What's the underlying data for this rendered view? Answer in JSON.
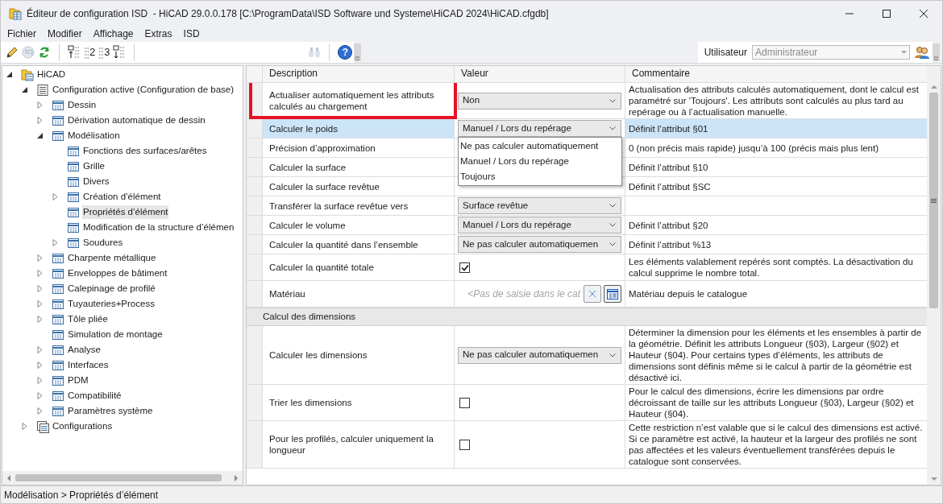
{
  "window": {
    "title": "Éditeur de configuration ISD  - HiCAD 29.0.0.178 [C:\\ProgramData\\ISD Software und Systeme\\HiCAD 2024\\HiCAD.cfgdb]"
  },
  "menu": [
    "Fichier",
    "Modifier",
    "Affichage",
    "Extras",
    "ISD"
  ],
  "toolbar": [
    {
      "kind": "pencil",
      "disabled": false
    },
    {
      "kind": "undo",
      "disabled": true
    },
    {
      "kind": "refresh",
      "disabled": false
    },
    {
      "kind": "separator"
    },
    {
      "kind": "level-up",
      "disabled": false
    },
    {
      "kind": "level",
      "label": "2",
      "disabled": false
    },
    {
      "kind": "level",
      "label": "3",
      "disabled": false
    },
    {
      "kind": "level-down",
      "disabled": false
    },
    {
      "kind": "separator"
    },
    {
      "kind": "binoculars",
      "disabled": true
    },
    {
      "kind": "separator"
    },
    {
      "kind": "help",
      "label": "?",
      "disabled": false
    }
  ],
  "user": {
    "label": "Utilisateur",
    "value": "Administrateur",
    "disabled": true
  },
  "tree": [
    {
      "label": "HiCAD",
      "kind": "root",
      "expanded": true,
      "selected": false,
      "children": [
        {
          "label": "Configuration active (Configuration de base)",
          "kind": "page",
          "expanded": true,
          "selected": false,
          "children": [
            {
              "label": "Dessin",
              "kind": "table",
              "expanded": false,
              "selected": false
            },
            {
              "label": "Dérivation automatique de dessin",
              "kind": "table",
              "expanded": false,
              "selected": false
            },
            {
              "label": "Modélisation",
              "kind": "table",
              "expanded": true,
              "selected": false,
              "children": [
                {
                  "label": "Fonctions des surfaces/arêtes",
                  "kind": "table",
                  "selected": false
                },
                {
                  "label": "Grille",
                  "kind": "table",
                  "selected": false
                },
                {
                  "label": "Divers",
                  "kind": "table",
                  "selected": false
                },
                {
                  "label": "Création d’élément",
                  "kind": "table",
                  "expanded": false,
                  "selected": false
                },
                {
                  "label": "Propriétés d’élément",
                  "kind": "table",
                  "selected": true
                },
                {
                  "label": "Modification de la structure d’élémen",
                  "kind": "table",
                  "selected": false
                },
                {
                  "label": "Soudures",
                  "kind": "table",
                  "expanded": false,
                  "selected": false
                }
              ]
            },
            {
              "label": "Charpente métallique",
              "kind": "table",
              "expanded": false,
              "selected": false
            },
            {
              "label": "Enveloppes de bâtiment",
              "kind": "table",
              "expanded": false,
              "selected": false
            },
            {
              "label": "Calepinage de profilé",
              "kind": "table",
              "expanded": false,
              "selected": false
            },
            {
              "label": "Tuyauteries+Process",
              "kind": "table",
              "expanded": false,
              "selected": false
            },
            {
              "label": "Tôle pliée",
              "kind": "table",
              "expanded": false,
              "selected": false
            },
            {
              "label": "Simulation de montage",
              "kind": "table",
              "selected": false
            },
            {
              "label": "Analyse",
              "kind": "table",
              "expanded": false,
              "selected": false
            },
            {
              "label": "Interfaces",
              "kind": "table",
              "expanded": false,
              "selected": false
            },
            {
              "label": "PDM",
              "kind": "table",
              "expanded": false,
              "selected": false
            },
            {
              "label": "Compatibilité",
              "kind": "table",
              "expanded": false,
              "selected": false
            },
            {
              "label": "Paramètres système",
              "kind": "table",
              "expanded": false,
              "selected": false
            }
          ]
        },
        {
          "label": "Configurations",
          "kind": "list",
          "expanded": false,
          "selected": false
        }
      ]
    }
  ],
  "grid": {
    "columns": [
      "Description",
      "Valeur",
      "Commentaire"
    ],
    "rows": [
      {
        "kind": "dropdown",
        "description": "Actualiser automatiquement les attributs calculés au chargement",
        "value": "Non",
        "comment": "Actualisation des attributs calculés automatiquement, dont le calcul est paramétré sur 'Toujours'. Les attributs sont calculés au plus tard au repérage ou à l’actualisation manuelle.",
        "selected": false,
        "highlighted": true
      },
      {
        "kind": "dropdown",
        "description": "Calculer le poids",
        "value": "Manuel / Lors du repérage",
        "comment": "Définit l’attribut §01",
        "selected": true,
        "highlighted": false,
        "options": [
          "Ne pas calculer automatiquement",
          "Manuel / Lors du repérage",
          "Toujours"
        ]
      },
      {
        "kind": "text",
        "description": "Précision d’approximation",
        "comment": "0 (non précis mais rapide) jusqu’à 100 (précis mais plus lent)",
        "selected": false,
        "highlighted": false
      },
      {
        "kind": "text",
        "description": "Calculer la surface",
        "comment": "Définit l’attribut §10",
        "selected": false,
        "highlighted": false
      },
      {
        "kind": "text",
        "description": "Calculer la surface revêtue",
        "comment": "Définit l’attribut §SC",
        "selected": false,
        "highlighted": false
      },
      {
        "kind": "dropdown",
        "description": "Transférer la surface revêtue vers",
        "value": "Surface revêtue",
        "selected": false,
        "highlighted": false
      },
      {
        "kind": "dropdown",
        "description": "Calculer le volume",
        "value": "Manuel / Lors du repérage",
        "comment": "Définit l’attribut §20",
        "selected": false,
        "highlighted": false
      },
      {
        "kind": "dropdown",
        "description": "Calculer la quantité dans l’ensemble",
        "value": "Ne pas calculer automatiquemen",
        "comment": "Définit l’attribut %13",
        "selected": false,
        "highlighted": false
      },
      {
        "kind": "checkbox",
        "description": "Calculer la quantité totale",
        "checked": true,
        "comment": "Les éléments valablement repérés sont comptés. La désactivation du calcul supprime le nombre total.",
        "selected": false,
        "highlighted": false
      },
      {
        "kind": "catalog",
        "description": "Matériau",
        "placeholder": "<Pas de saisie dans le cat",
        "comment": "Matériau depuis le catalogue",
        "selected": false,
        "highlighted": false
      },
      {
        "kind": "section",
        "description": "Calcul des dimensions"
      },
      {
        "kind": "dropdown",
        "description": "Calculer les dimensions",
        "value": "Ne pas calculer automatiquemen",
        "comment": "Déterminer la dimension pour les éléments et les ensembles à partir de la géométrie. Définit les attributs Longueur (§03), Largeur (§02) et Hauteur (§04). Pour certains types d’éléments, les attributs de dimensions sont définis même si le calcul à partir de la géométrie est désactivé ici.",
        "selected": false,
        "highlighted": false
      },
      {
        "kind": "checkbox",
        "description": "Trier les dimensions",
        "checked": false,
        "comment": "Pour le calcul des dimensions, écrire les dimensions par ordre décroissant de taille sur les attributs Longueur (§03), Largeur (§02) et Hauteur (§04).",
        "selected": false,
        "highlighted": false
      },
      {
        "kind": "checkbox",
        "description": "Pour les profilés, calculer uniquement la longueur",
        "checked": false,
        "comment": "Cette restriction n’est valable que si le calcul des dimensions est activé. Si ce paramètre est activé, la hauteur et la largeur des profilés ne sont pas affectées et les valeurs éventuellement transférées depuis le catalogue sont conservées.",
        "selected": false,
        "highlighted": false
      }
    ]
  },
  "status_bar": "Modélisation > Propriétés d’élément"
}
